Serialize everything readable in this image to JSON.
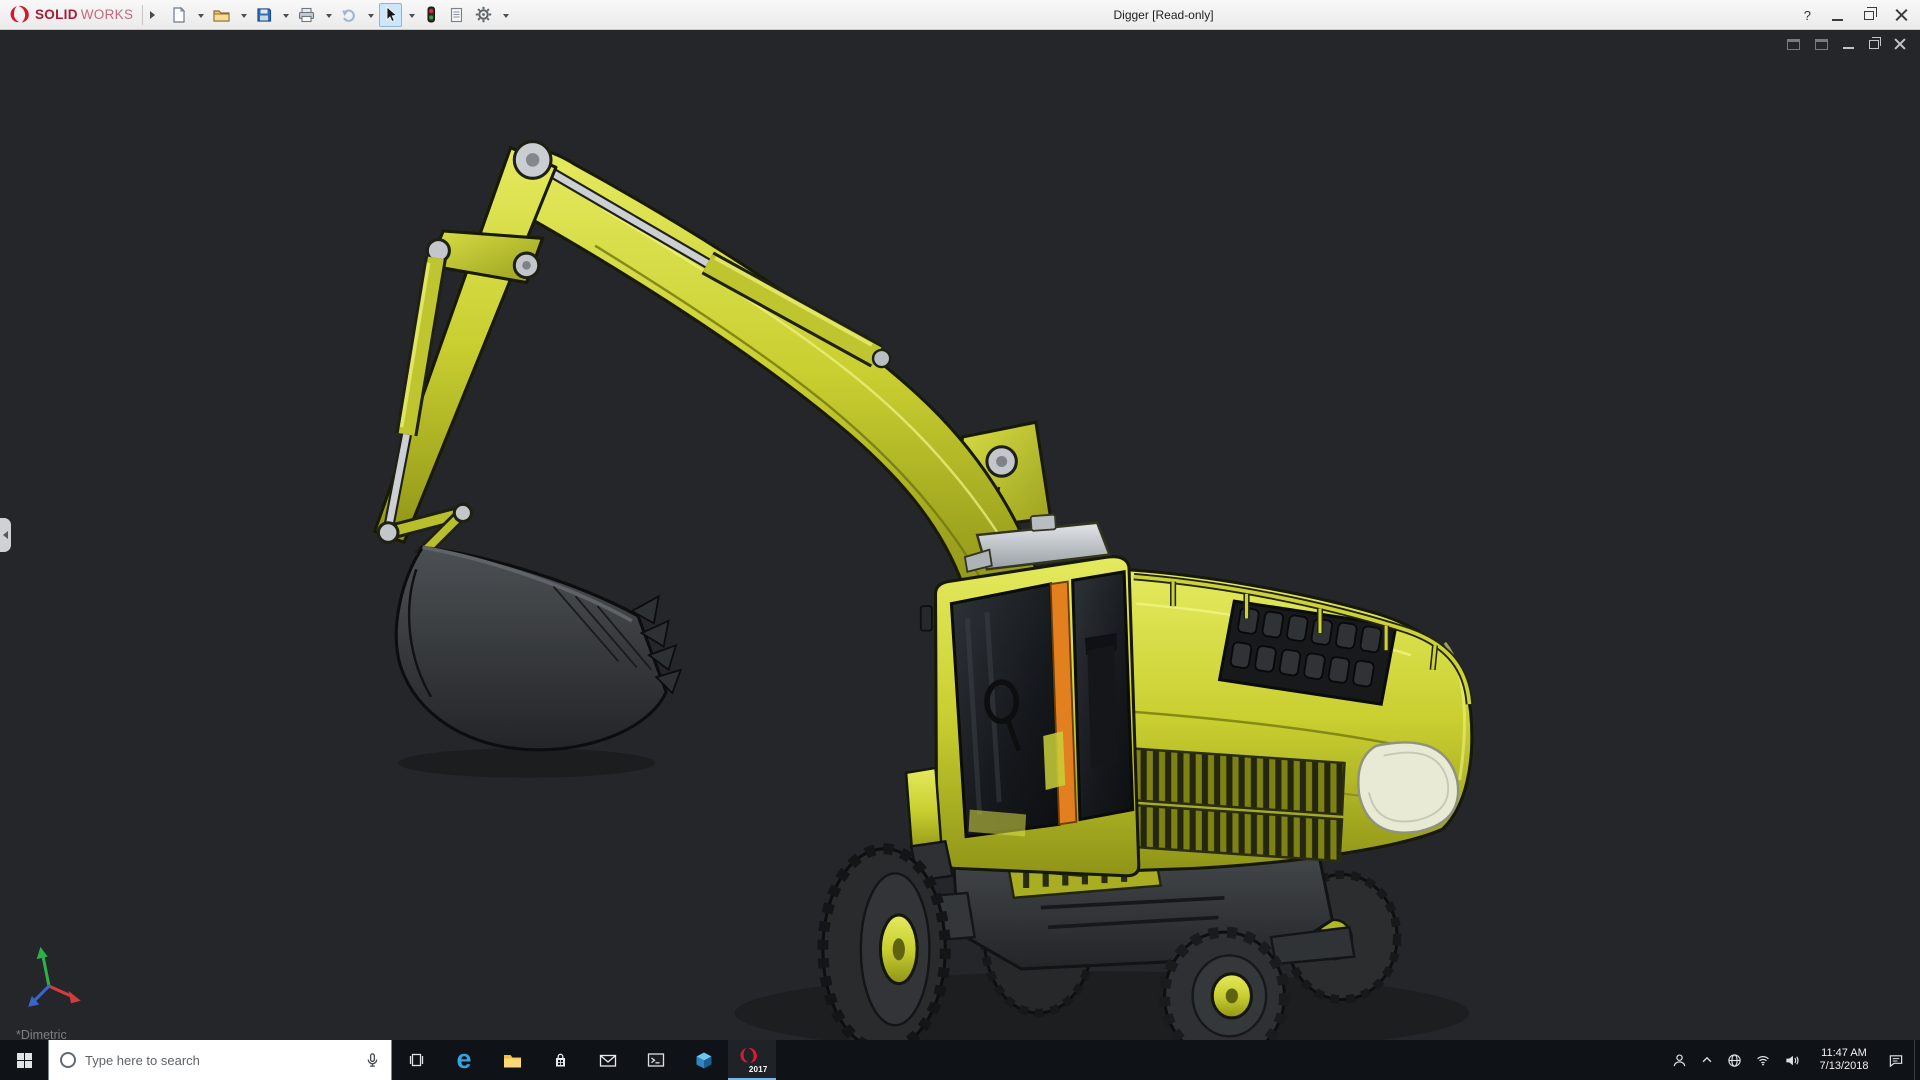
{
  "titlebar": {
    "logo": {
      "solid": "SOLID",
      "works": "WORKS"
    },
    "title": "Digger [Read-only]",
    "help_label": "?",
    "tools": [
      "new-document",
      "open",
      "save",
      "print",
      "undo",
      "select",
      "rebuild",
      "file-properties",
      "options"
    ]
  },
  "viewport": {
    "view_label": "*Dimetric",
    "doc_controls": [
      "split-pane",
      "full-pane",
      "minimize",
      "restore",
      "close"
    ]
  },
  "taskbar": {
    "search_placeholder": "Type here to search",
    "edge_glyph": "e",
    "sw_year": "2017",
    "clock": {
      "time": "11:47 AM",
      "date": "7/13/2018"
    },
    "icons": [
      "start",
      "cortana",
      "microphone",
      "task-view",
      "edge",
      "file-explorer",
      "store",
      "mail",
      "console",
      "cad-cube",
      "solidworks"
    ],
    "tray_icons": [
      "people",
      "hidden-icons",
      "network",
      "wifi",
      "volume",
      "action-center"
    ]
  },
  "colors": {
    "machine_yellow": "#c9cf30",
    "accent_orange": "#e2801f",
    "logo_red": "#d6152f",
    "viewport_bg": "#242629",
    "taskbar_bg": "#0f1216",
    "titlebar_bg": "#f1f1f1"
  }
}
